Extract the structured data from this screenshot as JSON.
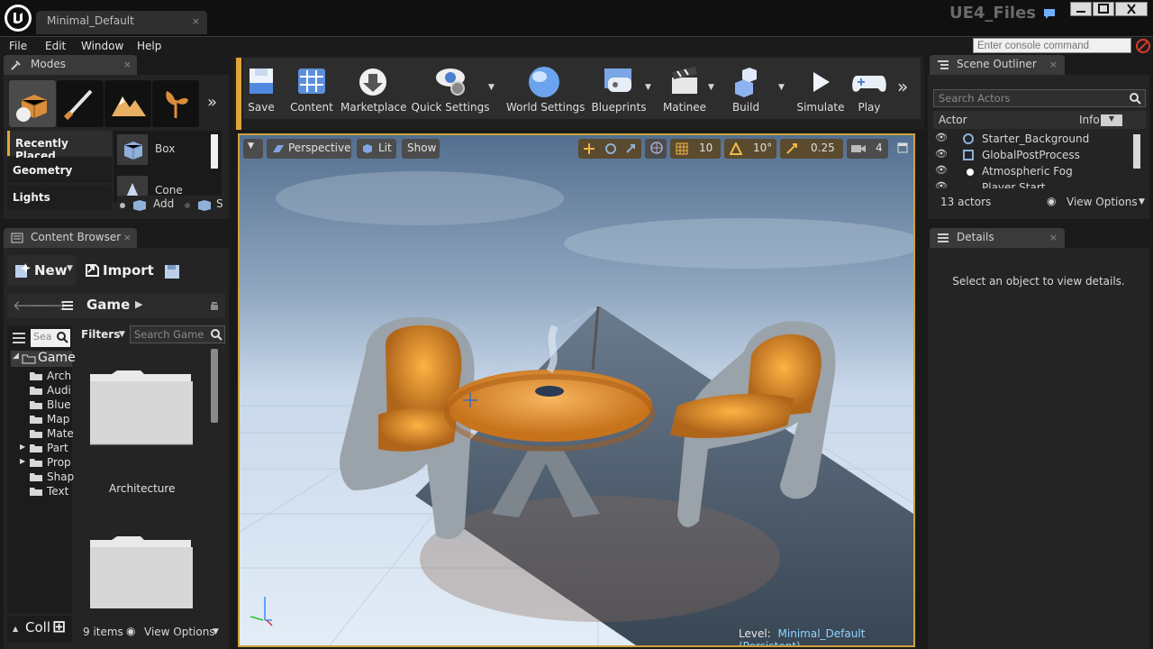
{
  "title_bar": {
    "doc_tab": "Minimal_Default",
    "close": "×",
    "project": "UE4_Files"
  },
  "menu": [
    "File",
    "Edit",
    "Window",
    "Help"
  ],
  "console": {
    "placeholder": "Enter console command"
  },
  "modes": {
    "tab": "Modes",
    "categories": [
      "Recently Placed",
      "Geometry",
      "Lights"
    ],
    "items": [
      "Box",
      "Cone"
    ],
    "add_label": "Add",
    "sub_label": "S"
  },
  "content_browser": {
    "tab": "Content Browser",
    "new_label": "New",
    "import_label": "Import",
    "path": "Game",
    "search_placeholder": "Sea",
    "filters_label": "Filters",
    "search_game": "Search Game",
    "tree": [
      "Game",
      "Arch",
      "Audi",
      "Blue",
      "Map",
      "Mate",
      "Part",
      "Prop",
      "Shap",
      "Text"
    ],
    "folders": [
      "Architecture"
    ],
    "collections_label": "Coll",
    "count": "9 items",
    "view_options": "View Options"
  },
  "toolbar": [
    "Save",
    "Content",
    "Marketplace",
    "Quick Settings",
    "World Settings",
    "Blueprints",
    "Matinee",
    "Build",
    "Simulate",
    "Play"
  ],
  "viewport": {
    "perspective": "Perspective",
    "lit": "Lit",
    "show": "Show",
    "grid": "10",
    "angle": "10°",
    "scale": "0.25",
    "cam_speed": "4",
    "level_label": "Level:",
    "level_name": "Minimal_Default (Persistent)"
  },
  "outliner": {
    "tab": "Scene Outliner",
    "search": "Search Actors",
    "col_actor": "Actor",
    "col_info": "Info",
    "rows": [
      "Starter_Background",
      "GlobalPostProcess",
      "Atmospheric Fog",
      "Player Start"
    ],
    "count": "13 actors",
    "view_options": "View Options"
  },
  "details": {
    "tab": "Details",
    "empty": "Select an object to view details."
  },
  "colors": {
    "accent_orange": "#d6a23a",
    "link_blue": "#8fd3ff",
    "panel": "#242424"
  }
}
